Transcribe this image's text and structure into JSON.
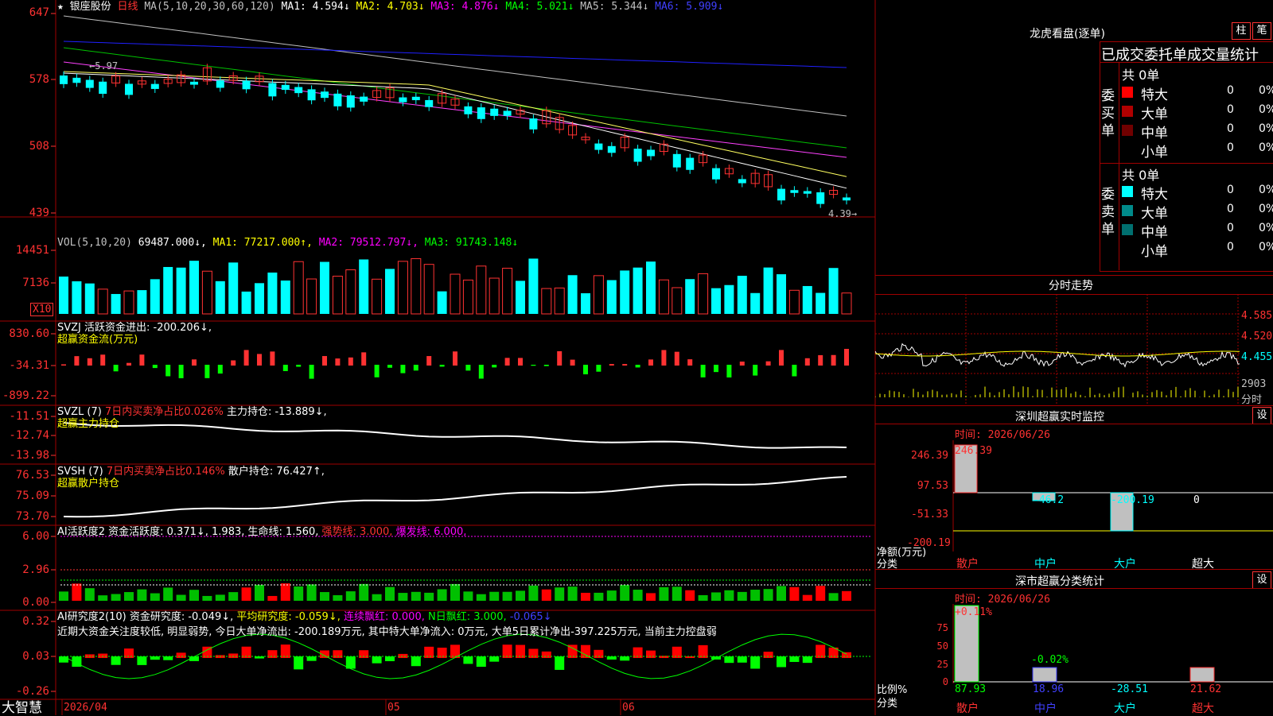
{
  "chart_header": {
    "star": "★",
    "stock_name": "银座股份",
    "period": "日线",
    "ma_label": "MA(5,10,20,30,60,120)",
    "ma1": "MA1: 4.594↓",
    "ma2": "MA2: 4.703↓",
    "ma3": "MA3: 4.876↓",
    "ma4": "MA4: 5.021↓",
    "ma5": "MA5: 5.344↓",
    "ma6": "MA6: 5.909↓",
    "high_mark": "5.97",
    "low_mark": "4.39"
  },
  "price_axis": [
    "647",
    "578",
    "508",
    "439"
  ],
  "vol_panel": {
    "title": "VOL(5,10,20)",
    "value": "69487.000↓,",
    "ma1": "MA1: 77217.000↑,",
    "ma2": "MA2: 79512.797↓,",
    "ma3": "MA3: 91743.148↓",
    "axis": [
      "14451",
      "7136"
    ],
    "unit": "X10"
  },
  "svzj_panel": {
    "title": "SVZJ  活跃资金进出: -200.206↓,",
    "subtitle": "超赢资金流(万元)",
    "axis": [
      "830.60",
      "-34.31",
      "-899.22"
    ]
  },
  "svzl_panel": {
    "title_a": "SVZL (7)",
    "title_b": "7日内买卖净占比0.026%",
    "title_c": "主力持仓: -13.889↓,",
    "subtitle": "超赢主力持仓",
    "axis": [
      "-11.51",
      "-12.74",
      "-13.98"
    ]
  },
  "svsh_panel": {
    "title_a": "SVSH (7)",
    "title_b": "7日内买卖净占比0.146%",
    "title_c": "散户持仓: 76.427↑,",
    "subtitle": "超赢散户持仓",
    "axis": [
      "76.53",
      "75.09",
      "73.70"
    ]
  },
  "ai_active_panel": {
    "title_a": "AI活跃度2 资金活跃度: 0.371↓,",
    "title_b": "1.983,",
    "title_c": "生命线: 1.560,",
    "title_d": "强势线: 3.000,",
    "title_e": "爆发线: 6.000,",
    "axis": [
      "6.00",
      "2.96",
      "0.00"
    ]
  },
  "ai_research_panel": {
    "title_a": "AI研究度2(10) 资金研究度: -0.049↓,",
    "title_b": "平均研究度: -0.059↓,",
    "title_c": "连续飘红: 0.000,",
    "title_d": "N日飘红: 3.000,",
    "title_e": "-0.065↓",
    "comment": "近期大资金关注度较低, 明显弱势, 今日大单净流出: -200.189万元, 其中特大单净流入: 0万元, 大单5日累计净出-397.225万元, 当前主力控盘弱",
    "axis": [
      "0.32",
      "0.03",
      "-0.26"
    ]
  },
  "bottom_bar": {
    "brand": "大智慧",
    "date_start": "2026/04",
    "month_05": "05",
    "month_06": "06"
  },
  "longhu": {
    "title": "龙虎看盘(逐单)",
    "btn_column": "柱",
    "btn_pen": "笔",
    "subtitle": "已成交委托单成交量统计",
    "buy_side": {
      "label": "委买单",
      "total": "共 0单",
      "rows": [
        {
          "name": "特大",
          "count": "0",
          "pct": "0%",
          "color": "#ff0000"
        },
        {
          "name": "大单",
          "count": "0",
          "pct": "0%",
          "color": "#b00000"
        },
        {
          "name": "中单",
          "count": "0",
          "pct": "0%",
          "color": "#700000"
        },
        {
          "name": "小单",
          "count": "0",
          "pct": "0%",
          "color": "#000000"
        }
      ]
    },
    "sell_side": {
      "label": "委卖单",
      "total": "共 0单",
      "rows": [
        {
          "name": "特大",
          "count": "0",
          "pct": "0%",
          "color": "#00ffff"
        },
        {
          "name": "大单",
          "count": "0",
          "pct": "0%",
          "color": "#008b8b"
        },
        {
          "name": "中单",
          "count": "0",
          "pct": "0%",
          "color": "#007070"
        },
        {
          "name": "小单",
          "count": "0",
          "pct": "0%",
          "color": "#000000"
        }
      ]
    }
  },
  "intraday": {
    "title": "分时走势",
    "axis": [
      "4.585",
      "4.520",
      "4.455"
    ],
    "vol_axis": "2903",
    "vol_unit": "分时"
  },
  "sz_monitor": {
    "title": "深圳超赢实时监控",
    "btn": "设",
    "time_label": "时间: 2026/06/26",
    "axis": [
      "246.39",
      "97.53",
      "-51.33",
      "-200.19"
    ],
    "unit_label": "净额(万元)",
    "cat_label": "分类",
    "bars": [
      {
        "name": "散户",
        "value": "246.39"
      },
      {
        "name": "中户",
        "value": "-46.2"
      },
      {
        "name": "大户",
        "value": "-200.19"
      },
      {
        "name": "超大",
        "value": "0"
      }
    ]
  },
  "sz_classify": {
    "title": "深市超赢分类统计",
    "btn": "设",
    "time_label": "时间: 2026/06/26",
    "axis": [
      "75",
      "50",
      "25",
      "0"
    ],
    "unit_label": "比例%",
    "cat_label": "分类",
    "top_labels": [
      "+0.11%",
      "-0.02%"
    ],
    "bars": [
      {
        "name": "散户",
        "value": "87.93"
      },
      {
        "name": "中户",
        "value": "18.96"
      },
      {
        "name": "大户",
        "value": "-28.51"
      },
      {
        "name": "超大",
        "value": "21.62"
      }
    ]
  },
  "chart_data": [
    {
      "type": "candlestick",
      "title": "银座股份 日线",
      "ylim": [
        439,
        647
      ],
      "high": 5.97,
      "low": 4.39
    },
    {
      "type": "bar",
      "title": "VOL(5,10,20)",
      "ylim": [
        0,
        14451
      ]
    },
    {
      "type": "bar",
      "title": "深圳超赢实时监控",
      "categories": [
        "散户",
        "中户",
        "大户",
        "超大"
      ],
      "values": [
        246.39,
        -46.2,
        -200.19,
        0
      ],
      "ylim": [
        -200.19,
        246.39
      ]
    },
    {
      "type": "bar",
      "title": "深市超赢分类统计",
      "categories": [
        "散户",
        "中户",
        "大户",
        "超大"
      ],
      "values": [
        87.93,
        18.96,
        -28.51,
        21.62
      ],
      "ylim": [
        0,
        75
      ]
    }
  ]
}
